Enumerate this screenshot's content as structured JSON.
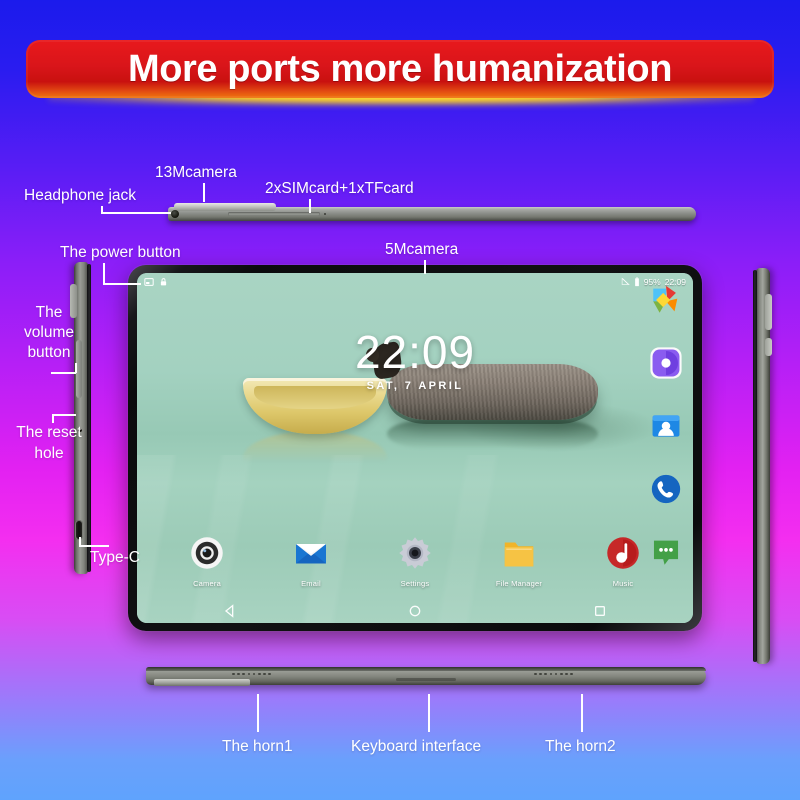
{
  "banner": {
    "title": "More ports more humanization",
    "bg_color": "#d9151a",
    "glow_color": "#ffd21a",
    "text_color": "#ffffff"
  },
  "background": {
    "top_color": "#1b1bec",
    "mid_color": "#f42ef0",
    "bottom_color": "#5fa3fd"
  },
  "callouts": [
    {
      "id": "headphone-jack",
      "label": "Headphone jack"
    },
    {
      "id": "camera-13m",
      "label": "13Mcamera"
    },
    {
      "id": "sim-tf",
      "label": "2xSIMcard+1xTFcard"
    },
    {
      "id": "power-button",
      "label": "The power button"
    },
    {
      "id": "camera-5m",
      "label": "5Mcamera"
    },
    {
      "id": "volume-button",
      "label": "The volume button"
    },
    {
      "id": "reset-hole",
      "label": "The reset hole"
    },
    {
      "id": "type-c",
      "label": "Type-C"
    },
    {
      "id": "horn1",
      "label": "The horn1"
    },
    {
      "id": "keyboard-interface",
      "label": "Keyboard interface"
    },
    {
      "id": "horn2",
      "label": "The horn2"
    }
  ],
  "tablet_screen": {
    "statusbar": {
      "left_icons": [
        "screenshot-icon",
        "lock-icon"
      ],
      "signal_icon": "signal-off-icon",
      "battery_icon": "battery-icon",
      "battery_level": "95%",
      "time": "22:09"
    },
    "clock_widget": {
      "time": "22:09",
      "date": "SAT, 7 APRIL"
    },
    "side_icons": [
      {
        "id": "gallery-icon",
        "name": "gallery-icon"
      },
      {
        "id": "browser-icon",
        "name": "browser-icon"
      },
      {
        "id": "contacts-icon",
        "name": "contacts-icon"
      },
      {
        "id": "phone-icon",
        "name": "phone-icon"
      },
      {
        "id": "messages-icon",
        "name": "messages-icon"
      }
    ],
    "dock": [
      {
        "id": "camera",
        "label": "Camera",
        "icon": "camera-icon"
      },
      {
        "id": "email",
        "label": "Email",
        "icon": "email-icon"
      },
      {
        "id": "settings",
        "label": "Settings",
        "icon": "gear-icon"
      },
      {
        "id": "file-manager",
        "label": "File Manager",
        "icon": "folder-icon"
      },
      {
        "id": "music",
        "label": "Music",
        "icon": "music-icon"
      }
    ],
    "navbar": [
      {
        "id": "back",
        "icon": "back-triangle-icon"
      },
      {
        "id": "home",
        "icon": "home-circle-icon"
      },
      {
        "id": "recents",
        "icon": "recents-square-icon"
      }
    ]
  }
}
